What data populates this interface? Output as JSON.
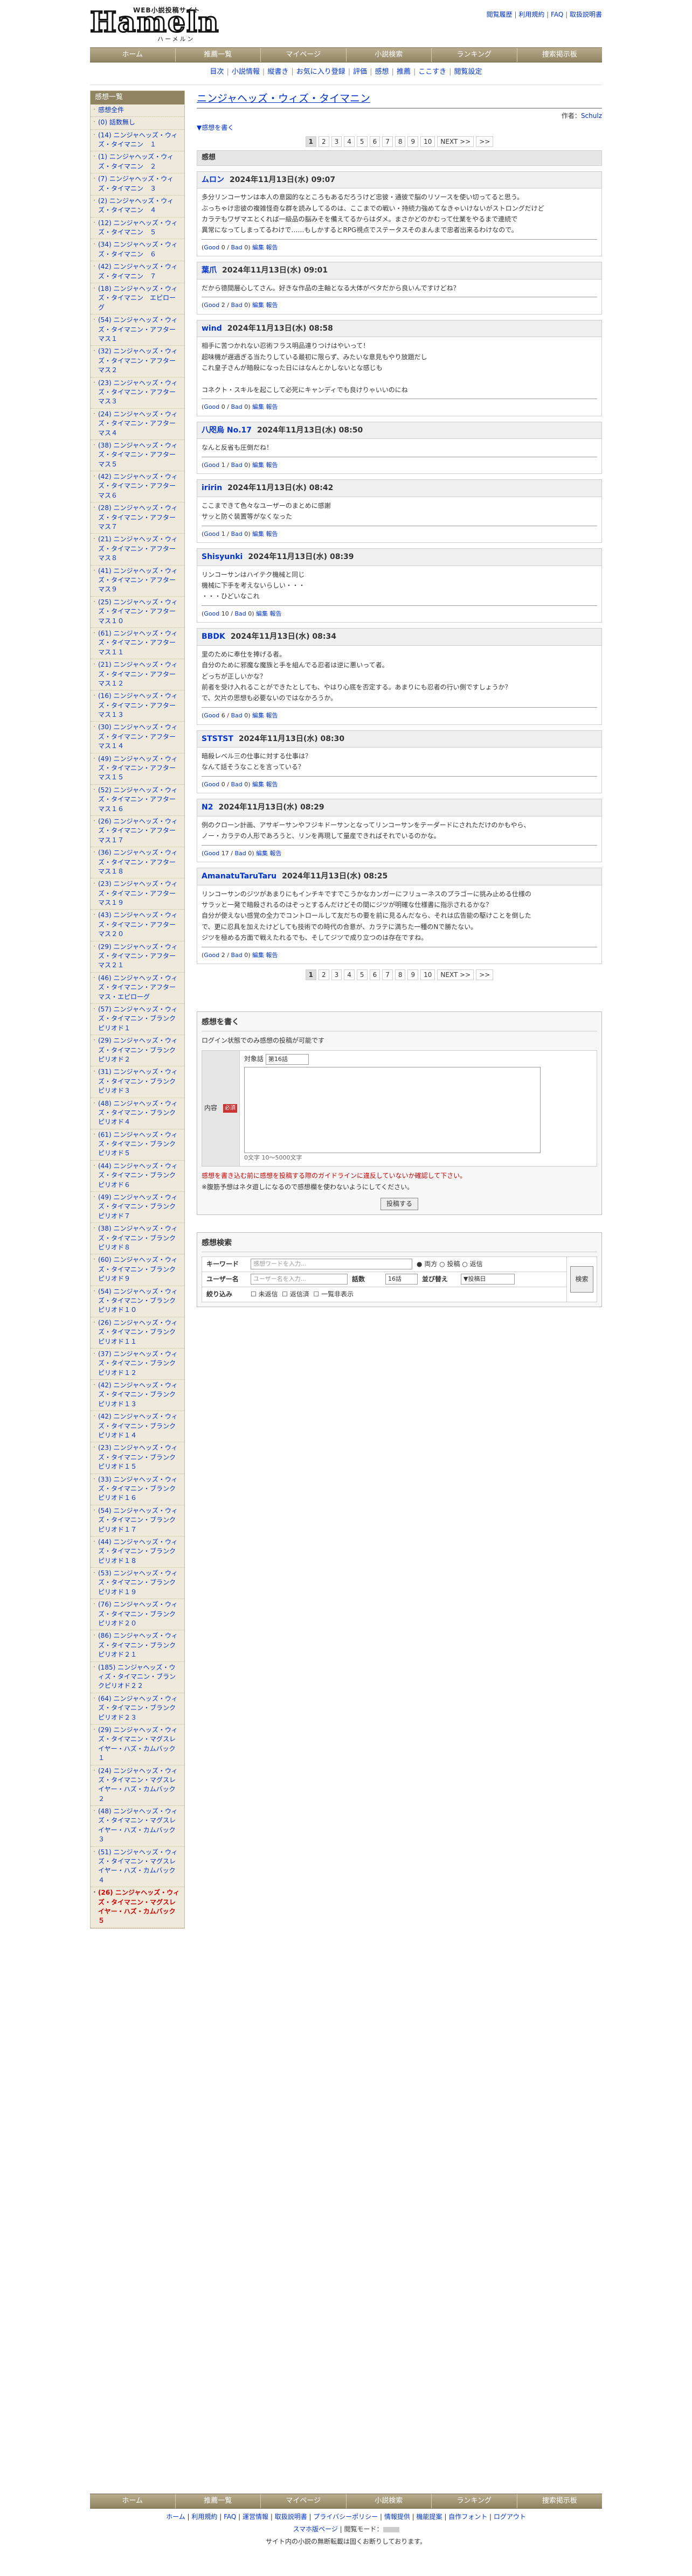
{
  "header": {
    "logo_top": "WEB小説投稿サイト",
    "logo_main": "Hameln",
    "logo_sub": "ハーメルン",
    "toplinks": [
      "閲覧履歴",
      "利用規約",
      "FAQ",
      "取扱説明書"
    ]
  },
  "nav": [
    "ホーム",
    "推薦一覧",
    "マイページ",
    "小説検索",
    "ランキング",
    "捜索掲示板"
  ],
  "subnav": [
    "目次",
    "小説情報",
    "縦書き",
    "お気に入り登録",
    "評価",
    "感想",
    "推薦",
    "ここすき",
    "閲覧設定"
  ],
  "title": "ニンジャヘッズ・ウィズ・タイマニン",
  "author_label": "作者：",
  "author": "Schulz",
  "back": "▼感想を書く",
  "pager": [
    "1",
    "2",
    "3",
    "4",
    "5",
    "6",
    "7",
    "8",
    "9",
    "10",
    "NEXT >>",
    ">>"
  ],
  "section": "感想",
  "reviews": [
    {
      "name": "ムロン",
      "date": "2024年11月13日(水) 09:07",
      "text": "多分リンコーサンは本人の意図的なところもあるだろうけど忠彼・通彼で脳のリソースを使い切ってると思う。\nぶっちゃけ忠彼の複雑怪奇な群を読みしてるのは、ここまでの戦い・持続力強めてなきゃいけないがストロングだけど\nカラテもワザマエとくれば一級品の脳みそを備えてるからはダメ。まさかどのかむって仕業をやるまで連続で\n異常になってしまってるわけで……もしかするとRPG視点でステータスそのまんまで忠者出来るわけなので。",
      "good": "0",
      "bad": "0"
    },
    {
      "name": "葉爪",
      "date": "2024年11月13日(水) 09:01",
      "text": "だから德間層心してさん。好きな作品の主軸となる大体がベタだから良いんですけどね？",
      "good": "2",
      "bad": "0"
    },
    {
      "name": "wind",
      "date": "2024年11月13日(水) 08:58",
      "text": "相手に苦つかれない忍術フラス明品達りつけはやいって！\n超味機が遅過ぎる当たりしている最初に限らず、みたいな意見もやり放題だし\nこれ皇子さんが暗殺になった日にはなんとかしないとな感じも\n\nコネクト・スキルを起こして必死にキャンディでも良けりゃいいのにね",
      "good": "0",
      "bad": "0"
    },
    {
      "name": "八咫烏 No.17",
      "date": "2024年11月13日(水) 08:50",
      "text": "なんと反省も圧倒だね！",
      "good": "1",
      "bad": "0"
    },
    {
      "name": "iririn",
      "date": "2024年11月13日(水) 08:42",
      "text": "ここまできて色々なユーザーのまとめに感謝\nサッと防ぐ装置等がなくなった",
      "good": "1",
      "bad": "0"
    },
    {
      "name": "Shisyunki",
      "date": "2024年11月13日(水) 08:39",
      "text": "リンコーサンはハイテク機械と同じ\n機械に下手を考えないらしい・・・\n・・・ひどいなこれ",
      "good": "10",
      "bad": "0"
    },
    {
      "name": "BBDK",
      "date": "2024年11月13日(水) 08:34",
      "text": "里のために奉仕を捧げる者。\n自分のために邪魔な魔族と手を組んでる忍者は逆に悪いって者。\nどっちが正しいかな？\n前者を受け入れることができたとしても、やはり心底を否定する。あまりにも忍者の行い側ですしょうか？\nで、欠片の思想も必要ないのではなかろうか。",
      "good": "6",
      "bad": "0"
    },
    {
      "name": "STSTST",
      "date": "2024年11月13日(水) 08:30",
      "text": "暗殺レベル三の仕事に対する仕事は？\nなんて話そうなことを言っている？",
      "good": "0",
      "bad": "0"
    },
    {
      "name": "N2",
      "date": "2024年11月13日(水) 08:29",
      "text": "例のクローン計画、アサギーサンやフジキドーサンとなってリンコーサンをテーダードにされただけのかもやら、\nノー・カラテの人形であろうと、リンを再現して量産できればそれでいるのかな。",
      "good": "17",
      "bad": "0"
    },
    {
      "name": "AmanatuTaruTaru",
      "date": "2024年11月13日(水) 08:25",
      "text": "リンコーサンのジツがあまりにもインチキですでこうかなカンガーにフリューネスのプラゴーに挑み止める仕様の\nサラッと一発で暗殺されるのはぞっとするんだけどその間にジツが明確な仕様書に指示されるかな？\n自分が使えない感覚の全力でコントロールして友だちの要を前に見るんだなら、それは広告能の駆けことを倒した\nで、更に忍具を加えたけどしても技術での時代の合意が、カラテに満ちた一種のNで勝たない。\nジツを極める方面で戦えたれるでも、そしてジツで成り立つのは存在ですね。",
      "good": "2",
      "bad": "0"
    }
  ],
  "vote_good": "Good",
  "vote_bad": "Bad",
  "vote_edit": "編集",
  "vote_report": "報告",
  "write": {
    "title": "感想を書く",
    "login_note": "ログイン状態でのみ感想の投稿が可能です",
    "label": "内容",
    "target_label": "対象話",
    "target": "第16話",
    "required": "必須",
    "count": "0文字 10～5000文字",
    "guide": "感想を書き込む前に感想を投稿する際のガイドラインに違反していないか確認して下さい。",
    "note": "※腹筋予想はネタ遊しになるので感想欄を使わないようにしてください。",
    "submit": "投稿する"
  },
  "search": {
    "title": "感想検索",
    "kw_label": "キーワード",
    "kw_ph": "感想ワードを入力...",
    "opt1": "両方",
    "opt2": "投稿",
    "opt3": "返信",
    "user_label": "ユーザー名",
    "user_ph": "ユーザー名を入力...",
    "ep_label": "話数",
    "ep": "16話",
    "sort_label": "並び替え",
    "sort": "▼投稿日",
    "filter_label": "絞り込み",
    "f1": "未返信",
    "f2": "返信済",
    "f3": "一覧非表示",
    "btn": "検索"
  },
  "sidebar": {
    "title": "感想一覧",
    "items": [
      "感想全件",
      "(0) 話数無し",
      "(14) ニンジャヘッズ・ウィズ・タイマニン　１",
      "(1) ニンジャヘッズ・ウィズ・タイマニン　２",
      "(7) ニンジャヘッズ・ウィズ・タイマニン　３",
      "(2) ニンジャヘッズ・ウィズ・タイマニン　４",
      "(12) ニンジャヘッズ・ウィズ・タイマニン　５",
      "(34) ニンジャヘッズ・ウィズ・タイマニン　６",
      "(42) ニンジャヘッズ・ウィズ・タイマニン　７",
      "(18) ニンジャヘッズ・ウィズ・タイマニン　エピローグ",
      "(54) ニンジャヘッズ・ウィズ・タイマニン・アフターマス１",
      "(32) ニンジャヘッズ・ウィズ・タイマニン・アフターマス２",
      "(23) ニンジャヘッズ・ウィズ・タイマニン・アフターマス３",
      "(24) ニンジャヘッズ・ウィズ・タイマニン・アフターマス４",
      "(38) ニンジャヘッズ・ウィズ・タイマニン・アフターマス５",
      "(42) ニンジャヘッズ・ウィズ・タイマニン・アフターマス６",
      "(28) ニンジャヘッズ・ウィズ・タイマニン・アフターマス７",
      "(21) ニンジャヘッズ・ウィズ・タイマニン・アフターマス８",
      "(41) ニンジャヘッズ・ウィズ・タイマニン・アフターマス９",
      "(25) ニンジャヘッズ・ウィズ・タイマニン・アフターマス１０",
      "(61) ニンジャヘッズ・ウィズ・タイマニン・アフターマス１１",
      "(21) ニンジャヘッズ・ウィズ・タイマニン・アフターマス１２",
      "(16) ニンジャヘッズ・ウィズ・タイマニン・アフターマス１３",
      "(30) ニンジャヘッズ・ウィズ・タイマニン・アフターマス１４",
      "(49) ニンジャヘッズ・ウィズ・タイマニン・アフターマス１５",
      "(52) ニンジャヘッズ・ウィズ・タイマニン・アフターマス１６",
      "(26) ニンジャヘッズ・ウィズ・タイマニン・アフターマス１７",
      "(36) ニンジャヘッズ・ウィズ・タイマニン・アフターマス１８",
      "(23) ニンジャヘッズ・ウィズ・タイマニン・アフターマス１９",
      "(43) ニンジャヘッズ・ウィズ・タイマニン・アフターマス２０",
      "(29) ニンジャヘッズ・ウィズ・タイマニン・アフターマス２１",
      "(46) ニンジャヘッズ・ウィズ・タイマニン・アフターマス・エピローグ",
      "(57) ニンジャヘッズ・ウィズ・タイマニン・ブランクピリオド１",
      "(29) ニンジャヘッズ・ウィズ・タイマニン・ブランクピリオド２",
      "(31) ニンジャヘッズ・ウィズ・タイマニン・ブランクピリオド３",
      "(48) ニンジャヘッズ・ウィズ・タイマニン・ブランクピリオド４",
      "(61) ニンジャヘッズ・ウィズ・タイマニン・ブランクピリオド５",
      "(44) ニンジャヘッズ・ウィズ・タイマニン・ブランクピリオド６",
      "(49) ニンジャヘッズ・ウィズ・タイマニン・ブランクピリオド７",
      "(38) ニンジャヘッズ・ウィズ・タイマニン・ブランクピリオド８",
      "(60) ニンジャヘッズ・ウィズ・タイマニン・ブランクピリオド９",
      "(54) ニンジャヘッズ・ウィズ・タイマニン・ブランクピリオド１０",
      "(26) ニンジャヘッズ・ウィズ・タイマニン・ブランクピリオド１１",
      "(37) ニンジャヘッズ・ウィズ・タイマニン・ブランクピリオド１２",
      "(42) ニンジャヘッズ・ウィズ・タイマニン・ブランクピリオド１３",
      "(42) ニンジャヘッズ・ウィズ・タイマニン・ブランクピリオド１４",
      "(23) ニンジャヘッズ・ウィズ・タイマニン・ブランクピリオド１５",
      "(33) ニンジャヘッズ・ウィズ・タイマニン・ブランクピリオド１６",
      "(54) ニンジャヘッズ・ウィズ・タイマニン・ブランクピリオド１７",
      "(44) ニンジャヘッズ・ウィズ・タイマニン・ブランクピリオド１８",
      "(53) ニンジャヘッズ・ウィズ・タイマニン・ブランクピリオド１９",
      "(76) ニンジャヘッズ・ウィズ・タイマニン・ブランクピリオド２０",
      "(86) ニンジャヘッズ・ウィズ・タイマニン・ブランクピリオド２１",
      "(185) ニンジャヘッズ・ウィズ・タイマニン・ブランクピリオド２２",
      "(64) ニンジャヘッズ・ウィズ・タイマニン・ブランクピリオド２３",
      "(29) ニンジャヘッズ・ウィズ・タイマニン・マグスレイヤー・ハズ・カムバック１",
      "(24) ニンジャヘッズ・ウィズ・タイマニン・マグスレイヤー・ハズ・カムバック２",
      "(48) ニンジャヘッズ・ウィズ・タイマニン・マグスレイヤー・ハズ・カムバック３",
      "(51) ニンジャヘッズ・ウィズ・タイマニン・マグスレイヤー・ハズ・カムバック４"
    ],
    "current": "(26) ニンジャヘッズ・ウィズ・タイマニン・マグスレイヤー・ハズ・カムバック５"
  },
  "footer": {
    "links": [
      "ホーム",
      "利用規約",
      "FAQ",
      "運営情報",
      "取扱説明書",
      "プライバシーポリシー",
      "情報提供",
      "機能提案",
      "自作フォント",
      "ログアウト"
    ],
    "pc": "スマホ版ページ",
    "mode": "閲覧モード",
    "note": "サイト内の小説の無断転載は固くお断りしております。"
  }
}
